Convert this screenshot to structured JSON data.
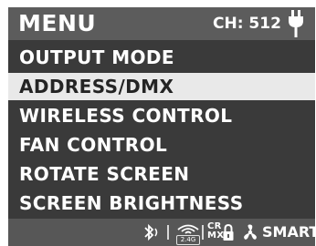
{
  "header": {
    "title": "MENU",
    "channel": "CH: 512",
    "power_icon": "power-plug-icon"
  },
  "menu": {
    "items": [
      {
        "label": "OUTPUT MODE",
        "selected": false
      },
      {
        "label": "ADDRESS/DMX",
        "selected": true
      },
      {
        "label": "WIRELESS CONTROL",
        "selected": false
      },
      {
        "label": "FAN CONTROL",
        "selected": false
      },
      {
        "label": "ROTATE SCREEN",
        "selected": false
      },
      {
        "label": "SCREEN BRIGHTNESS",
        "selected": false
      }
    ]
  },
  "status": {
    "bluetooth_icon": "bluetooth-icon",
    "wifi_band": "2.4G",
    "crmx_top": "CR",
    "crmx_bottom": "MX",
    "lock_icon": "lock-icon",
    "fan_icon": "fan-icon",
    "fan_mode": "SMART"
  },
  "colors": {
    "background": "#3a3a3a",
    "header": "#5c5c5c",
    "statusbar": "#575757",
    "selected_row": "#e9e9e9",
    "text": "#ffffff",
    "selected_text": "#242424"
  }
}
